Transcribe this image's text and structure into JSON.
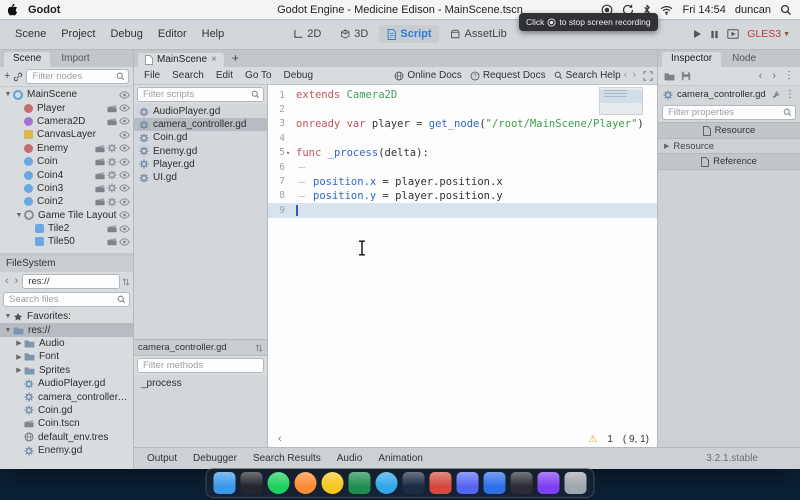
{
  "menubar": {
    "app_name": "Godot",
    "window_title": "Godot Engine - Medicine Edison - MainScene.tscn",
    "clock": "Fri 14:54",
    "user": "duncan"
  },
  "recording_tooltip": {
    "prefix": "Click",
    "suffix": "to stop screen recording"
  },
  "editor_toolbar": {
    "menus": [
      "Scene",
      "Project",
      "Debug",
      "Editor",
      "Help"
    ],
    "workspaces": [
      {
        "label": "2D",
        "active": false
      },
      {
        "label": "3D",
        "active": false
      },
      {
        "label": "Script",
        "active": true
      },
      {
        "label": "AssetLib",
        "active": false
      }
    ],
    "renderer": "GLES3",
    "accent_color": "#2f7bd9",
    "renderer_color": "#c23a31"
  },
  "scene_dock": {
    "tabs": [
      {
        "label": "Scene",
        "active": true
      },
      {
        "label": "Import",
        "active": false
      }
    ],
    "filter_placeholder": "Filter nodes",
    "nodes": [
      {
        "label": "MainScene",
        "depth": 0,
        "arrow": "down",
        "color": "#5aa4dd",
        "shape": "ring",
        "badges": [],
        "eye": true
      },
      {
        "label": "Player",
        "depth": 1,
        "arrow": null,
        "color": "#c46b6b",
        "shape": "dot",
        "badges": [
          "scene"
        ],
        "eye": true
      },
      {
        "label": "Camera2D",
        "depth": 1,
        "arrow": null,
        "color": "#a173d4",
        "shape": "dot",
        "badges": [
          "scene"
        ],
        "eye": true
      },
      {
        "label": "CanvasLayer",
        "depth": 1,
        "arrow": null,
        "color": "#d8b84a",
        "shape": "square",
        "badges": [],
        "eye": true
      },
      {
        "label": "Enemy",
        "depth": 1,
        "arrow": null,
        "color": "#c46b6b",
        "shape": "dot",
        "badges": [
          "scene",
          "script"
        ],
        "eye": true
      },
      {
        "label": "Coin",
        "depth": 1,
        "arrow": null,
        "color": "#6ba7e0",
        "shape": "dot",
        "badges": [
          "scene",
          "script"
        ],
        "eye": true
      },
      {
        "label": "Coin4",
        "depth": 1,
        "arrow": null,
        "color": "#6ba7e0",
        "shape": "dot",
        "badges": [
          "scene",
          "script"
        ],
        "eye": true
      },
      {
        "label": "Coin3",
        "depth": 1,
        "arrow": null,
        "color": "#6ba7e0",
        "shape": "dot",
        "badges": [
          "scene",
          "script"
        ],
        "eye": true
      },
      {
        "label": "Coin2",
        "depth": 1,
        "arrow": null,
        "color": "#6ba7e0",
        "shape": "dot",
        "badges": [
          "scene",
          "script"
        ],
        "eye": true
      },
      {
        "label": "Game Tile Layout",
        "depth": 1,
        "arrow": "down",
        "color": "#8a9096",
        "shape": "ring",
        "badges": [],
        "eye": true
      },
      {
        "label": "Tile2",
        "depth": 2,
        "arrow": null,
        "color": "#6ba7e0",
        "shape": "square",
        "badges": [
          "scene"
        ],
        "eye": true
      },
      {
        "label": "Tile50",
        "depth": 2,
        "arrow": null,
        "color": "#6ba7e0",
        "shape": "square",
        "badges": [
          "scene"
        ],
        "eye": true
      }
    ]
  },
  "filesystem_dock": {
    "title": "FileSystem",
    "path": "res://",
    "search_placeholder": "Search files",
    "items": [
      {
        "label": "Favorites:",
        "depth": 0,
        "icon": "star",
        "arrow": "down",
        "selected": false
      },
      {
        "label": "res://",
        "depth": 0,
        "icon": "folder",
        "arrow": "down",
        "selected": true
      },
      {
        "label": "Audio",
        "depth": 1,
        "icon": "folder",
        "arrow": "right",
        "selected": false
      },
      {
        "label": "Font",
        "depth": 1,
        "icon": "folder",
        "arrow": "right",
        "selected": false
      },
      {
        "label": "Sprites",
        "depth": 1,
        "icon": "folder",
        "arrow": "right",
        "selected": false
      },
      {
        "label": "AudioPlayer.gd",
        "depth": 1,
        "icon": "script",
        "arrow": null,
        "selected": false
      },
      {
        "label": "camera_controller.gd",
        "depth": 1,
        "icon": "script",
        "arrow": null,
        "selected": false
      },
      {
        "label": "Coin.gd",
        "depth": 1,
        "icon": "script",
        "arrow": null,
        "selected": false
      },
      {
        "label": "Coin.tscn",
        "depth": 1,
        "icon": "scene",
        "arrow": null,
        "selected": false
      },
      {
        "label": "default_env.tres",
        "depth": 1,
        "icon": "resource",
        "arrow": null,
        "selected": false
      },
      {
        "label": "Enemy.gd",
        "depth": 1,
        "icon": "script",
        "arrow": null,
        "selected": false
      }
    ]
  },
  "script_workspace": {
    "scene_tab_label": "MainScene",
    "menus": [
      "File",
      "Search",
      "Edit",
      "Go To",
      "Debug"
    ],
    "help_buttons": [
      {
        "label": "Online Docs",
        "icon": "globe"
      },
      {
        "label": "Request Docs",
        "icon": "question"
      },
      {
        "label": "Search Help",
        "icon": "magnifier"
      }
    ],
    "filter_scripts_placeholder": "Filter scripts",
    "scripts": [
      {
        "label": "AudioPlayer.gd",
        "selected": false
      },
      {
        "label": "camera_controller.gd",
        "selected": true
      },
      {
        "label": "Coin.gd",
        "selected": false
      },
      {
        "label": "Enemy.gd",
        "selected": false
      },
      {
        "label": "Player.gd",
        "selected": false
      },
      {
        "label": "UI.gd",
        "selected": false
      }
    ],
    "current_script": "camera_controller.gd",
    "filter_methods_placeholder": "Filter methods",
    "methods": [
      "_process"
    ],
    "code_lines": [
      {
        "n": "1",
        "tokens": [
          {
            "c": "kw",
            "s": "extends"
          },
          {
            "c": "t",
            "s": " "
          },
          {
            "c": "ty",
            "s": "Camera2D"
          }
        ]
      },
      {
        "n": "2",
        "tokens": []
      },
      {
        "n": "3",
        "tokens": [
          {
            "c": "kw",
            "s": "onready var"
          },
          {
            "c": "t",
            "s": " player = "
          },
          {
            "c": "fn",
            "s": "get_node"
          },
          {
            "c": "t",
            "s": "("
          },
          {
            "c": "st",
            "s": "\"/root/MainScene/Player\""
          },
          {
            "c": "t",
            "s": ")"
          }
        ]
      },
      {
        "n": "4",
        "tokens": []
      },
      {
        "n": "5",
        "fold": true,
        "tokens": [
          {
            "c": "kw",
            "s": "func"
          },
          {
            "c": "t",
            "s": " "
          },
          {
            "c": "fn",
            "s": "_process"
          },
          {
            "c": "t",
            "s": "(delta):"
          }
        ]
      },
      {
        "n": "6",
        "tokens": [
          {
            "c": "tab",
            "s": ""
          }
        ]
      },
      {
        "n": "7",
        "tokens": [
          {
            "c": "tab",
            "s": ""
          },
          {
            "c": "mem",
            "s": "position.x"
          },
          {
            "c": "t",
            "s": " = player.position.x"
          }
        ]
      },
      {
        "n": "8",
        "tokens": [
          {
            "c": "tab",
            "s": ""
          },
          {
            "c": "mem",
            "s": "position.y"
          },
          {
            "c": "t",
            "s": " = player.position.y"
          }
        ]
      },
      {
        "n": "9",
        "current": true,
        "tokens": []
      }
    ],
    "status": {
      "warning_count": "1",
      "caret_position": "( 9, 1)"
    }
  },
  "bottom_panel": {
    "buttons": [
      "Output",
      "Debugger",
      "Search Results",
      "Audio",
      "Animation"
    ],
    "version": "3.2.1.stable"
  },
  "inspector_dock": {
    "tabs": [
      {
        "label": "Inspector",
        "active": true
      },
      {
        "label": "Node",
        "active": false
      }
    ],
    "script_name": "camera_controller.gd",
    "filter_placeholder": "Filter properties",
    "sections": [
      {
        "label": "Resource",
        "style": "header"
      },
      {
        "label": "Resource",
        "style": "group"
      },
      {
        "label": "Reference",
        "style": "header"
      }
    ]
  },
  "dock": {
    "apps": [
      {
        "color": "#3b99e8",
        "shape": "rounded"
      },
      {
        "color": "#23262c",
        "shape": "rounded"
      },
      {
        "color": "#1ed05e",
        "shape": "circle"
      },
      {
        "color": "#ff8b33",
        "shape": "circle"
      },
      {
        "color": "#f6c71f",
        "shape": "circle"
      },
      {
        "color": "#1e8e4e",
        "shape": "rounded"
      },
      {
        "color": "#31a8e8",
        "shape": "circle"
      },
      {
        "color": "#1b2b45",
        "shape": "rounded"
      },
      {
        "color": "#d24b3e",
        "shape": "rounded"
      },
      {
        "color": "#5766f2",
        "shape": "rounded"
      },
      {
        "color": "#2e6fe8",
        "shape": "rounded"
      },
      {
        "color": "#2a2d33",
        "shape": "rounded"
      },
      {
        "color": "#7e3ff2",
        "shape": "rounded"
      },
      {
        "color": "#9fa6ad",
        "shape": "rounded"
      }
    ]
  }
}
